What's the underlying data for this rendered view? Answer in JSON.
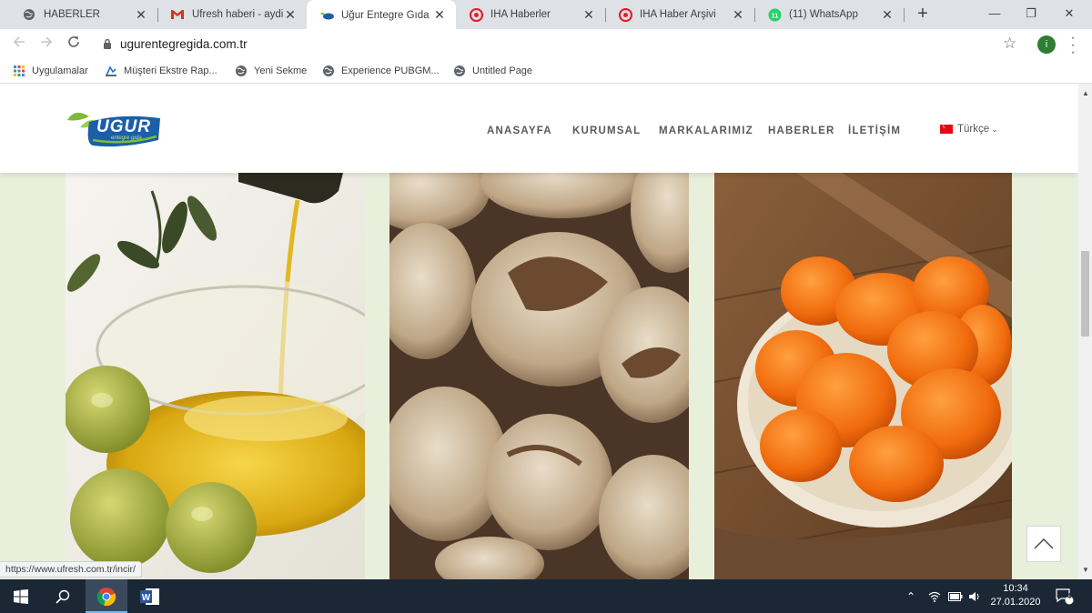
{
  "browser": {
    "tabs": [
      {
        "title": "HABERLER",
        "icon": "globe-icon",
        "active": false
      },
      {
        "title": "Ufresh haberi - aydi",
        "icon": "gmail-icon",
        "active": false
      },
      {
        "title": "Uğur Entegre Gıda",
        "icon": "ugur-favicon",
        "active": true
      },
      {
        "title": "İHA Haberler",
        "icon": "iha-icon",
        "active": false
      },
      {
        "title": "İHA Haber Arşivi",
        "icon": "iha-icon",
        "active": false
      },
      {
        "title": "(11) WhatsApp",
        "icon": "whatsapp-icon",
        "active": false
      }
    ],
    "whatsapp_badge": "11",
    "close_glyph": "✕",
    "new_tab_glyph": "+",
    "window_controls": {
      "minimize": "—",
      "restore": "❐",
      "close": "✕"
    },
    "url": "ugurentegregida.com.tr",
    "profile_initial": "i",
    "bookmarks": [
      {
        "label": "Uygulamalar",
        "icon": "apps-grid-icon"
      },
      {
        "label": "Müşteri Ekstre Rap...",
        "icon": "bookmark-page-icon"
      },
      {
        "label": "Yeni Sekme",
        "icon": "globe-icon"
      },
      {
        "label": "Experience PUBGM...",
        "icon": "globe-icon"
      },
      {
        "label": "Untitled Page",
        "icon": "globe-icon"
      }
    ],
    "status_url": "https://www.ufresh.com.tr/incir/"
  },
  "site": {
    "logo_text": "UGUR",
    "logo_sub": "entegre gıda",
    "nav": [
      "ANASAYFA",
      "KURUMSAL",
      "MARKALARIMIZ",
      "HABERLER",
      "İLETİŞİM"
    ],
    "language": "Türkçe",
    "products": [
      {
        "name": "olive-oil"
      },
      {
        "name": "dried-figs"
      },
      {
        "name": "dried-apricots"
      }
    ]
  },
  "taskbar": {
    "time": "10:34",
    "date": "27.01.2020",
    "notifications": "4",
    "word_letter": "W"
  },
  "colors": {
    "page_bg": "#e8f0dc",
    "taskbar_bg": "#1b2735",
    "logo_blue": "#1a5fa8",
    "logo_green": "#7dbb3a"
  }
}
